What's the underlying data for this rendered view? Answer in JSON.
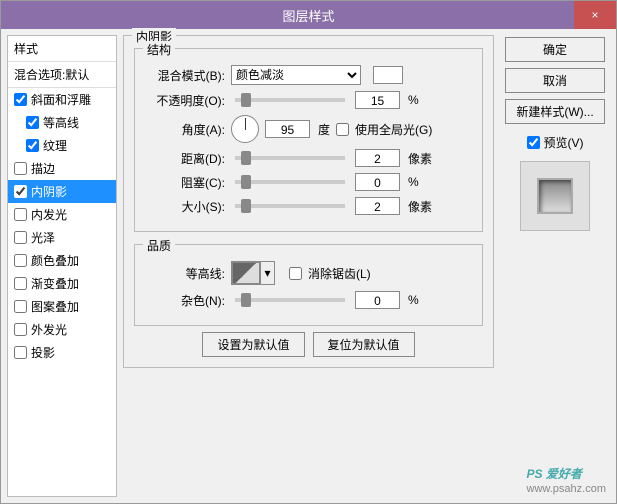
{
  "title": "图层样式",
  "close": "×",
  "left": {
    "header": "样式",
    "sub": "混合选项:默认",
    "items": [
      {
        "label": "斜面和浮雕",
        "checked": true
      },
      {
        "label": "等高线",
        "checked": true,
        "indent": true
      },
      {
        "label": "纹理",
        "checked": true,
        "indent": true
      },
      {
        "label": "描边",
        "checked": false
      },
      {
        "label": "内阴影",
        "checked": true,
        "selected": true
      },
      {
        "label": "内发光",
        "checked": false
      },
      {
        "label": "光泽",
        "checked": false
      },
      {
        "label": "颜色叠加",
        "checked": false
      },
      {
        "label": "渐变叠加",
        "checked": false
      },
      {
        "label": "图案叠加",
        "checked": false
      },
      {
        "label": "外发光",
        "checked": false
      },
      {
        "label": "投影",
        "checked": false
      }
    ]
  },
  "center": {
    "section_title": "内阴影",
    "struct_title": "结构",
    "blend_mode_label": "混合模式(B):",
    "blend_mode_value": "颜色减淡",
    "opacity_label": "不透明度(O):",
    "opacity_value": "15",
    "opacity_unit": "%",
    "angle_label": "角度(A):",
    "angle_value": "95",
    "angle_unit": "度",
    "global_light_label": "使用全局光(G)",
    "distance_label": "距离(D):",
    "distance_value": "2",
    "distance_unit": "像素",
    "choke_label": "阻塞(C):",
    "choke_value": "0",
    "choke_unit": "%",
    "size_label": "大小(S):",
    "size_value": "2",
    "size_unit": "像素",
    "quality_title": "品质",
    "contour_label": "等高线:",
    "antialias_label": "消除锯齿(L)",
    "noise_label": "杂色(N):",
    "noise_value": "0",
    "noise_unit": "%",
    "reset_default": "设置为默认值",
    "restore_default": "复位为默认值"
  },
  "right": {
    "ok": "确定",
    "cancel": "取消",
    "new_style": "新建样式(W)...",
    "preview_label": "预览(V)"
  },
  "watermark": {
    "main": "PS 爱好者",
    "sub": "www.psahz.com"
  }
}
